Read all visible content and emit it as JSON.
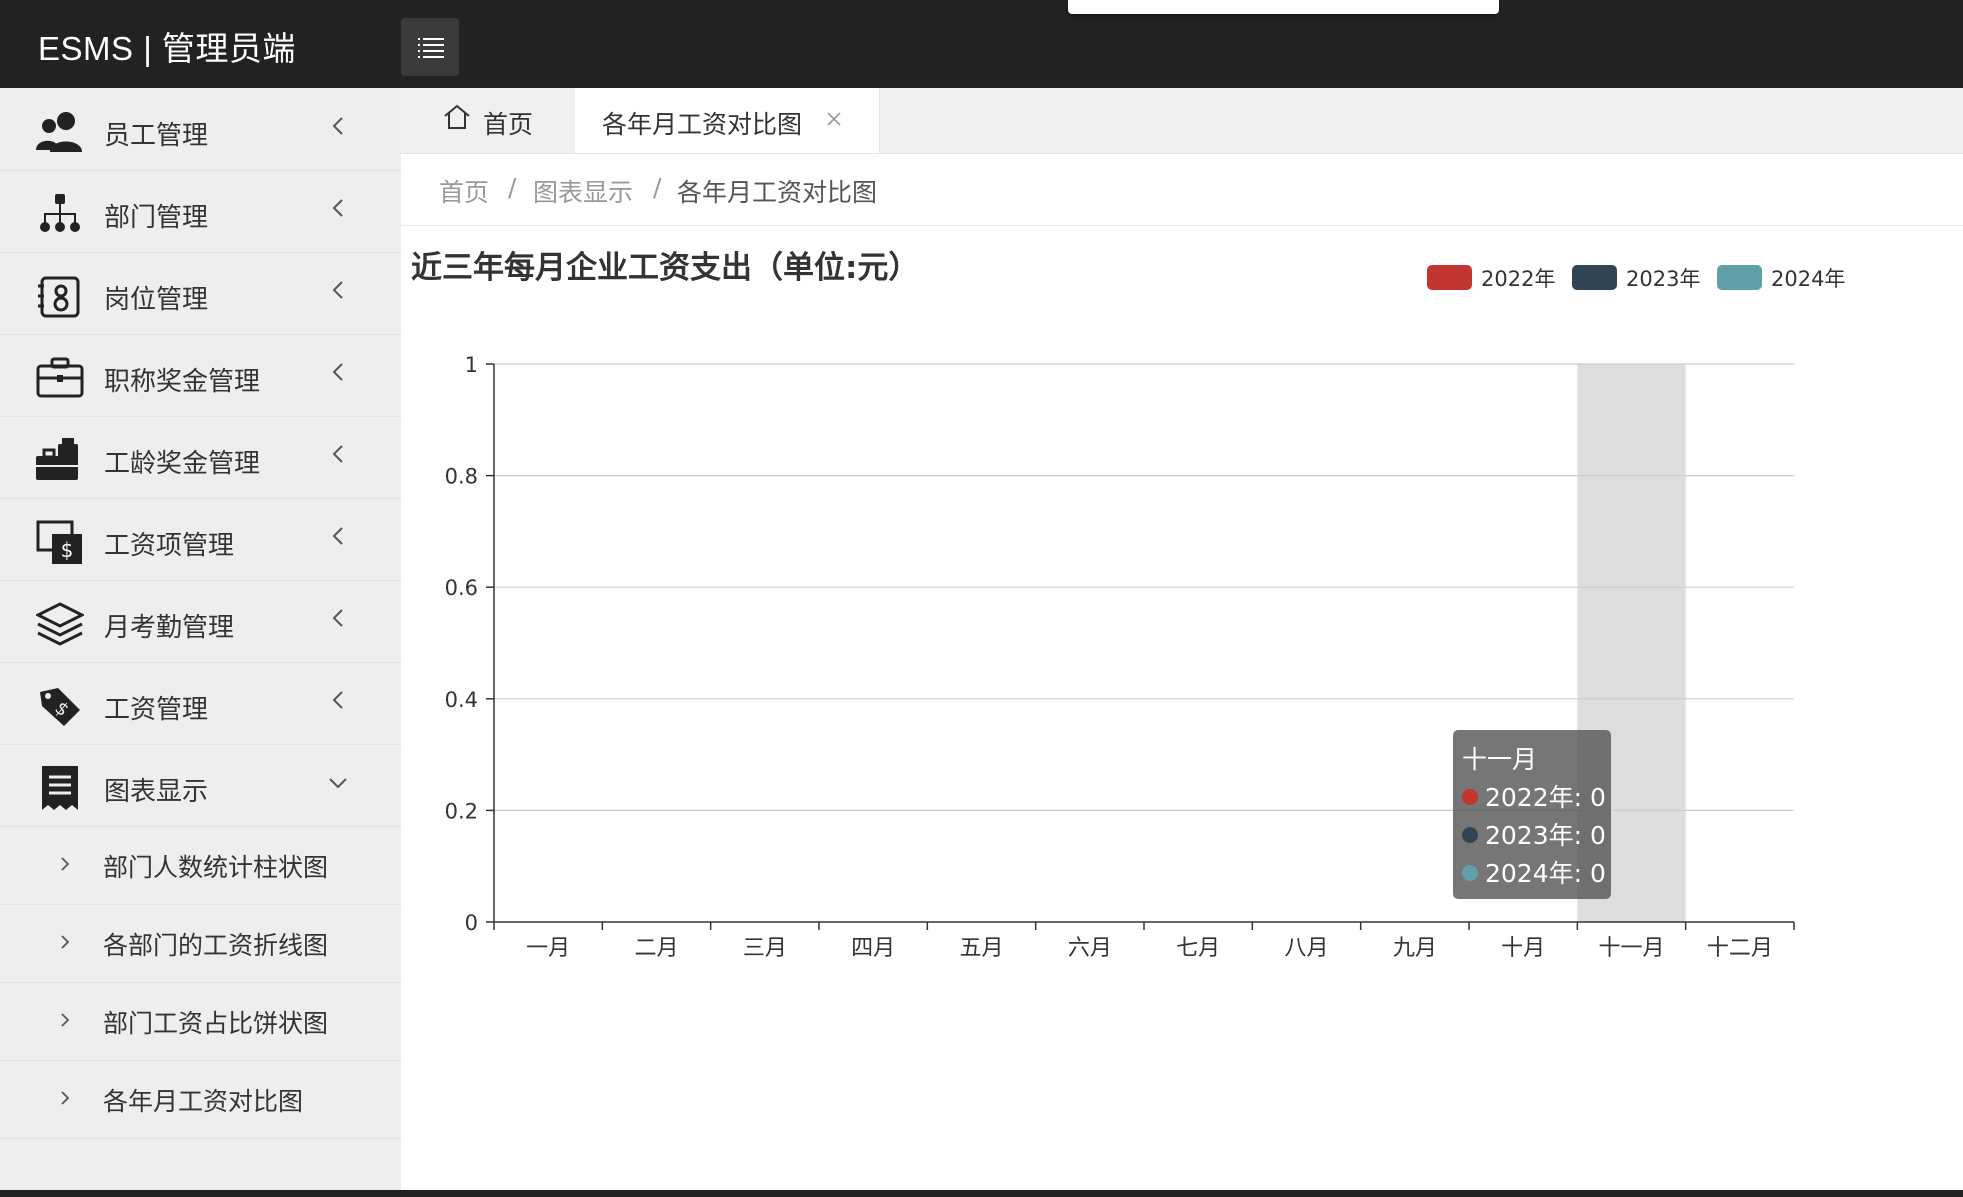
{
  "app": {
    "title": "ESMS | 管理员端"
  },
  "sidebar": {
    "items": [
      {
        "label": "员工管理",
        "icon": "user-group-icon",
        "expanded": false
      },
      {
        "label": "部门管理",
        "icon": "org-chart-icon",
        "expanded": false
      },
      {
        "label": "岗位管理",
        "icon": "id-badge-icon",
        "expanded": false
      },
      {
        "label": "职称奖金管理",
        "icon": "briefcase-icon",
        "expanded": false
      },
      {
        "label": "工龄奖金管理",
        "icon": "toolbox-icon",
        "expanded": false
      },
      {
        "label": "工资项管理",
        "icon": "salary-screen-icon",
        "expanded": false
      },
      {
        "label": "月考勤管理",
        "icon": "layers-icon",
        "expanded": false
      },
      {
        "label": "工资管理",
        "icon": "money-tag-icon",
        "expanded": false
      },
      {
        "label": "图表显示",
        "icon": "receipt-icon",
        "expanded": true
      }
    ],
    "subitems": [
      {
        "label": "部门人数统计柱状图"
      },
      {
        "label": "各部门的工资折线图"
      },
      {
        "label": "部门工资占比饼状图"
      },
      {
        "label": "各年月工资对比图"
      }
    ]
  },
  "tabs": {
    "home": "首页",
    "active": "各年月工资对比图"
  },
  "breadcrumb": {
    "home": "首页",
    "sep": "/",
    "section": "图表显示",
    "current": "各年月工资对比图"
  },
  "colors": {
    "topbar": "#222222",
    "sidebar": "#eeeeee",
    "series_2022": "#c23531",
    "series_2023": "#2f4554",
    "series_2024": "#61a0a8"
  },
  "chart_data": {
    "type": "bar",
    "title": "近三年每月企业工资支出（单位:元）",
    "categories": [
      "一月",
      "二月",
      "三月",
      "四月",
      "五月",
      "六月",
      "七月",
      "八月",
      "九月",
      "十月",
      "十一月",
      "十二月"
    ],
    "series": [
      {
        "name": "2022年",
        "color": "#c23531",
        "values": [
          0,
          0,
          0,
          0,
          0,
          0,
          0,
          0,
          0,
          0,
          0,
          0
        ]
      },
      {
        "name": "2023年",
        "color": "#2f4554",
        "values": [
          0,
          0,
          0,
          0,
          0,
          0,
          0,
          0,
          0,
          0,
          0,
          0
        ]
      },
      {
        "name": "2024年",
        "color": "#61a0a8",
        "values": [
          0,
          0,
          0,
          0,
          0,
          0,
          0,
          0,
          0,
          0,
          0,
          0
        ]
      }
    ],
    "ylim": [
      0,
      1
    ],
    "yticks": [
      "0",
      "0.2",
      "0.4",
      "0.6",
      "0.8",
      "1"
    ],
    "grid": true,
    "legend_position": "top-right",
    "highlighted_category": "十一月"
  },
  "tooltip": {
    "title": "十一月",
    "rows": [
      "2022年: 0",
      "2023年: 0",
      "2024年: 0"
    ]
  }
}
